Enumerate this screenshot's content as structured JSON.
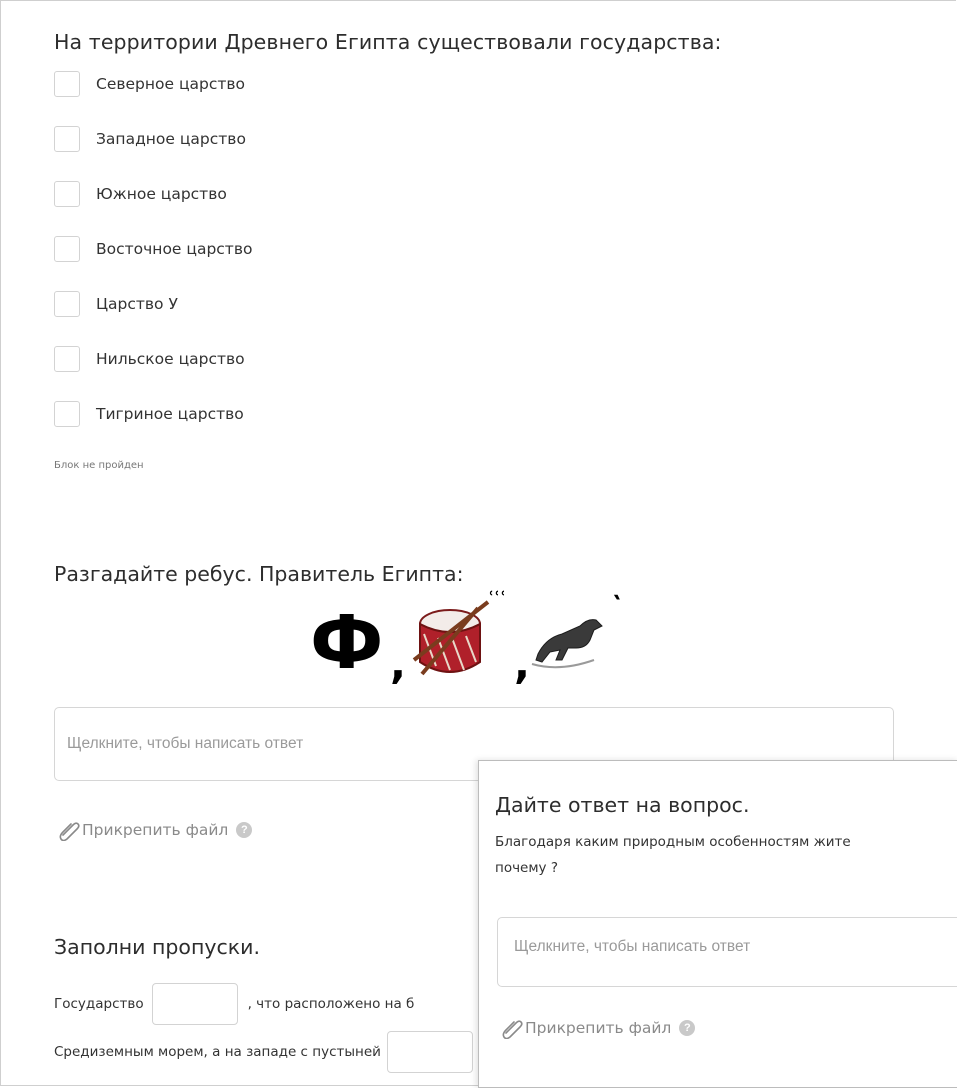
{
  "question1": {
    "title": "На территории Древнего Египта существовали государства:",
    "options": [
      {
        "label": "Северное царство",
        "checked": false
      },
      {
        "label": "Западное царство",
        "checked": false
      },
      {
        "label": "Южное царство",
        "checked": false
      },
      {
        "label": "Восточное царство",
        "checked": false
      },
      {
        "label": "Царство У",
        "checked": false
      },
      {
        "label": "Нильское царство",
        "checked": false
      },
      {
        "label": "Тигриное царство",
        "checked": false
      }
    ],
    "status": "Блок не пройден"
  },
  "question2": {
    "title": "Разгадайте ребус. Правитель Египта:",
    "rebus": {
      "letter": "Ф",
      "comma1": ",",
      "marks1": "ՙՙՙ",
      "comma2": ",",
      "mark2": "՝",
      "images": [
        "drum-icon",
        "horse-icon"
      ]
    },
    "answer_placeholder": "Щелкните, чтобы написать ответ",
    "attach_label": "Прикрепить файл",
    "help_glyph": "?"
  },
  "question3": {
    "title": "Заполни пропуски.",
    "line1_prefix": "Государство",
    "line1_suffix": ", что расположено на б",
    "line2_prefix": "Средиземным морем, а на западе с пустыней"
  },
  "popup": {
    "title": "Дайте ответ на вопрос.",
    "question_line1": "Благодаря каким природным особенностям жите",
    "question_line2": "почему ?",
    "answer_placeholder": "Щелкните, чтобы написать ответ",
    "attach_label": "Прикрепить файл",
    "help_glyph": "?"
  },
  "colors": {
    "text": "#2d2d2d",
    "placeholder": "#9a9a9a",
    "border": "#d3d3d3",
    "muted": "#8a8a8a",
    "drum_red": "#b0202a"
  }
}
